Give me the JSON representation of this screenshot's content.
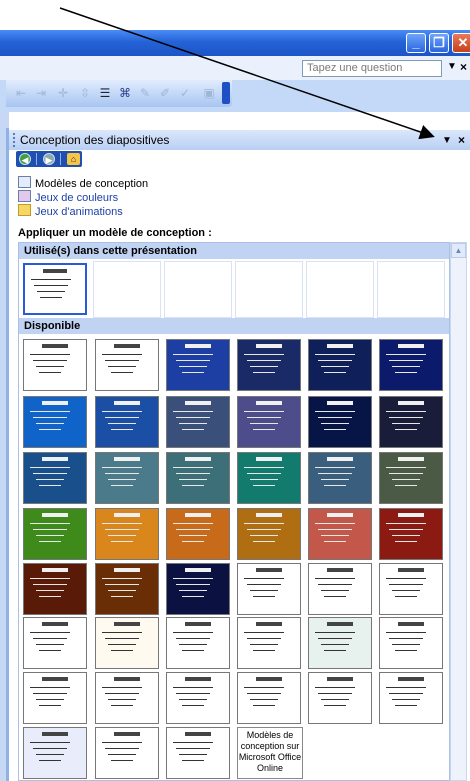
{
  "window": {
    "question_placeholder": "Tapez une question"
  },
  "task_pane": {
    "title": "Conception des diapositives",
    "links": [
      {
        "label": "Modèles de conception"
      },
      {
        "label": "Jeux de couleurs"
      },
      {
        "label": "Jeux d'animations"
      }
    ],
    "apply_label": "Appliquer un modèle de conception :",
    "sections": {
      "used": "Utilisé(s) dans cette présentation",
      "available": "Disponible"
    },
    "online_tile": "Modèles de conception sur Microsoft Office Online"
  },
  "colors": {
    "accent": "#2463d6",
    "section": "#c1d3f3"
  },
  "icons": [
    "minimize-icon",
    "restore-icon",
    "close-icon",
    "back-icon",
    "forward-icon",
    "home-icon"
  ]
}
